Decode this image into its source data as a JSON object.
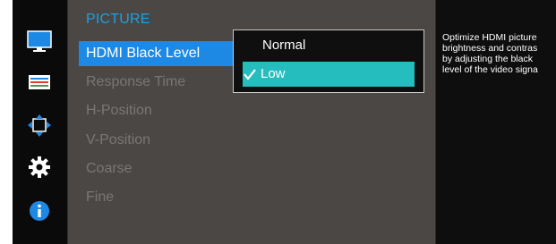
{
  "icons": [
    {
      "name": "monitor-icon",
      "selected": true
    },
    {
      "name": "onscreen-display-icon",
      "selected": false
    },
    {
      "name": "move-arrows-icon",
      "selected": false
    },
    {
      "name": "gear-icon",
      "selected": false
    },
    {
      "name": "info-icon",
      "selected": false
    }
  ],
  "menu": {
    "title": "PICTURE",
    "items": [
      {
        "label": "HDMI Black Level"
      },
      {
        "label": "Response Time"
      },
      {
        "label": "H-Position"
      },
      {
        "label": "V-Position"
      },
      {
        "label": "Coarse"
      },
      {
        "label": "Fine"
      }
    ]
  },
  "submenu": {
    "options": [
      {
        "label": "Normal"
      },
      {
        "label": "Low"
      }
    ]
  },
  "help": {
    "lines": [
      "Optimize HDMI picture",
      "brightness and contras",
      "by adjusting the black",
      "level of the video signa"
    ]
  },
  "colors": {
    "accent_blue": "#1e88e5",
    "title_blue": "#1aa0e6",
    "selected_teal": "#26bdbf",
    "disabled_gray": "#7a7674",
    "panel_gray": "#4b4744"
  }
}
